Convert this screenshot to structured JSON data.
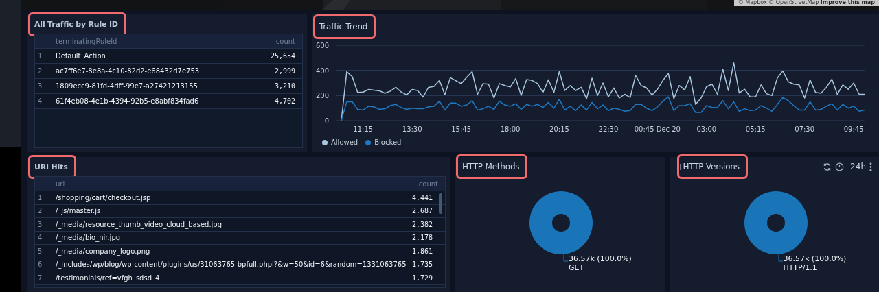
{
  "map": {
    "kind": "picture",
    "attribution": "© Mapbox © OpenStreetMap **Improve this map**"
  },
  "rule_table": {
    "title": "All Traffic by Rule ID",
    "highlighted": true,
    "columns": [
      "terminatingRuleId",
      "count"
    ],
    "rows": [
      {
        "index": "1",
        "value": "Default_Action",
        "count": "25,654"
      },
      {
        "index": "2",
        "value": "ac7ff6e7-8e8a-4c10-82d2-e68432d7e753",
        "count": "2,999"
      },
      {
        "index": "3",
        "value": "1809ecc9-81fd-4dff-99e7-a27421213155",
        "count": "3,210"
      },
      {
        "index": "4",
        "value": "61f4eb08-4e1b-4394-92b5-e8abf834fad6",
        "count": "4,702"
      }
    ]
  },
  "traffic_trend": {
    "title": "Traffic Trend",
    "highlighted": true,
    "chart_data": {
      "type": "line",
      "ylim": [
        0,
        600
      ],
      "yticks": [
        0,
        200,
        400,
        600
      ],
      "categories": [
        null,
        null,
        null,
        null,
        "11:15",
        null,
        null,
        null,
        null,
        null,
        null,
        null,
        null,
        "13:30",
        null,
        null,
        null,
        null,
        null,
        null,
        null,
        null,
        "15:45",
        null,
        null,
        null,
        null,
        null,
        null,
        null,
        null,
        "18:00",
        null,
        null,
        null,
        null,
        null,
        null,
        null,
        null,
        "20:15",
        null,
        null,
        null,
        null,
        null,
        null,
        null,
        null,
        "22:30",
        null,
        null,
        null,
        null,
        null,
        null,
        null,
        null,
        "00:45 Dec 20",
        null,
        null,
        null,
        null,
        null,
        null,
        null,
        null,
        "03:00",
        null,
        null,
        null,
        null,
        null,
        null,
        null,
        null,
        "05:15",
        null,
        null,
        null,
        null,
        null,
        null,
        null,
        null,
        "07:30",
        null,
        null,
        null,
        null,
        null,
        null,
        null,
        null,
        "09:45",
        null,
        null
      ],
      "series": [
        {
          "name": "Allowed",
          "color": "#a9c6de",
          "values": [
            0,
            390,
            350,
            225,
            228,
            248,
            243,
            238,
            218,
            235,
            265,
            228,
            205,
            248,
            240,
            188,
            265,
            272,
            320,
            208,
            342,
            318,
            295,
            345,
            390,
            210,
            295,
            290,
            180,
            295,
            280,
            268,
            335,
            200,
            328,
            320,
            295,
            225,
            325,
            225,
            390,
            240,
            280,
            240,
            265,
            175,
            338,
            200,
            300,
            190,
            260,
            180,
            210,
            185,
            360,
            280,
            260,
            205,
            250,
            320,
            375,
            175,
            280,
            245,
            350,
            130,
            180,
            270,
            290,
            210,
            410,
            240,
            460,
            220,
            250,
            190,
            190,
            285,
            215,
            200,
            340,
            395,
            310,
            290,
            285,
            180,
            325,
            225,
            218,
            265,
            330,
            210,
            285,
            250,
            300,
            210,
            210
          ]
        },
        {
          "name": "Blocked",
          "color": "#1f78c1",
          "values": [
            0,
            150,
            150,
            90,
            85,
            115,
            110,
            90,
            95,
            120,
            130,
            105,
            90,
            100,
            95,
            95,
            110,
            115,
            155,
            85,
            140,
            140,
            115,
            125,
            160,
            85,
            95,
            115,
            90,
            155,
            125,
            115,
            135,
            90,
            130,
            115,
            130,
            105,
            145,
            100,
            170,
            85,
            115,
            80,
            125,
            85,
            145,
            95,
            125,
            80,
            100,
            90,
            75,
            80,
            130,
            130,
            100,
            80,
            110,
            155,
            190,
            80,
            120,
            120,
            135,
            65,
            65,
            120,
            105,
            105,
            160,
            95,
            150,
            75,
            95,
            80,
            85,
            120,
            100,
            75,
            130,
            185,
            160,
            120,
            85,
            85,
            150,
            85,
            90,
            115,
            135,
            85,
            130,
            100,
            115,
            75,
            85
          ]
        }
      ]
    }
  },
  "uri_hits": {
    "title": "URI Hits",
    "highlighted": true,
    "columns": [
      "uri",
      "count"
    ],
    "rows": [
      {
        "index": "1",
        "value": "/shopping/cart/checkout.jsp",
        "count": "4,441"
      },
      {
        "index": "2",
        "value": "/_js/master.js",
        "count": "2,687"
      },
      {
        "index": "3",
        "value": "/_media/resource_thumb_video_cloud_based.jpg",
        "count": "2,382"
      },
      {
        "index": "4",
        "value": "/_media/bio_nir.jpg",
        "count": "2,178"
      },
      {
        "index": "5",
        "value": "/_media/company_logo.png",
        "count": "1,861"
      },
      {
        "index": "6",
        "value": "/_includes/wp/blog/wp-content/plugins/us/31063765-bpfull.phpi?&w=50&id=6&random=1331063765",
        "count": "1,735"
      },
      {
        "index": "7",
        "value": "/testimonials/ref=vfgh_sdsd_4",
        "count": "1,729"
      }
    ]
  },
  "http_methods": {
    "title": "HTTP Methods",
    "highlighted": true,
    "chart_data": {
      "type": "pie",
      "categories": [
        "GET"
      ],
      "values": [
        100
      ],
      "value_labels": [
        "36.57k (100.0%)"
      ]
    }
  },
  "http_versions": {
    "title": "HTTP Versions",
    "highlighted": true,
    "time_range": "-24h",
    "chart_data": {
      "type": "pie",
      "categories": [
        "HTTP/1.1"
      ],
      "values": [
        100
      ],
      "value_labels": [
        "36.57k (100.0%)"
      ]
    }
  }
}
